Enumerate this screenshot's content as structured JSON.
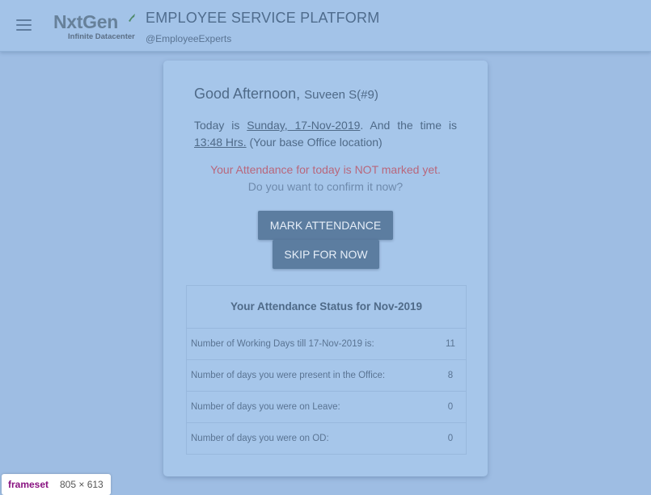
{
  "header": {
    "menu_icon": "hamburger-menu-icon",
    "logo": {
      "name": "NxtGen",
      "tagline": "Infinite Datacenter"
    },
    "title": "EMPLOYEE SERVICE PLATFORM",
    "subtitle": "@EmployeeExperts"
  },
  "greeting": {
    "salutation": "Good Afternoon,",
    "name": "Suveen S(#9)"
  },
  "date_info": {
    "prefix": "Today is",
    "date": "Sunday, 17-Nov-2019",
    "middle": ". And the time is",
    "time": "13:48 Hrs.",
    "suffix": "(Your base Office location)"
  },
  "attendance_warning": "Your Attendance for today is NOT marked yet.",
  "attendance_question": "Do you want to confirm it now?",
  "buttons": {
    "mark": "MARK ATTENDANCE",
    "skip": "SKIP FOR NOW"
  },
  "status": {
    "title": "Your Attendance Status for Nov-2019",
    "rows": [
      {
        "label": "Number of Working Days till 17-Nov-2019 is:",
        "value": "11"
      },
      {
        "label": "Number of days you were present in the Office:",
        "value": "8"
      },
      {
        "label": "Number of days you were on Leave:",
        "value": "0"
      },
      {
        "label": "Number of days you were on OD:",
        "value": "0"
      }
    ]
  },
  "devtools_tooltip": {
    "tag": "frameset",
    "size": "805 × 613"
  },
  "colors": {
    "accent_button": "#5c7da0",
    "warning_text": "#b8677c",
    "background": "#9ebde3"
  }
}
